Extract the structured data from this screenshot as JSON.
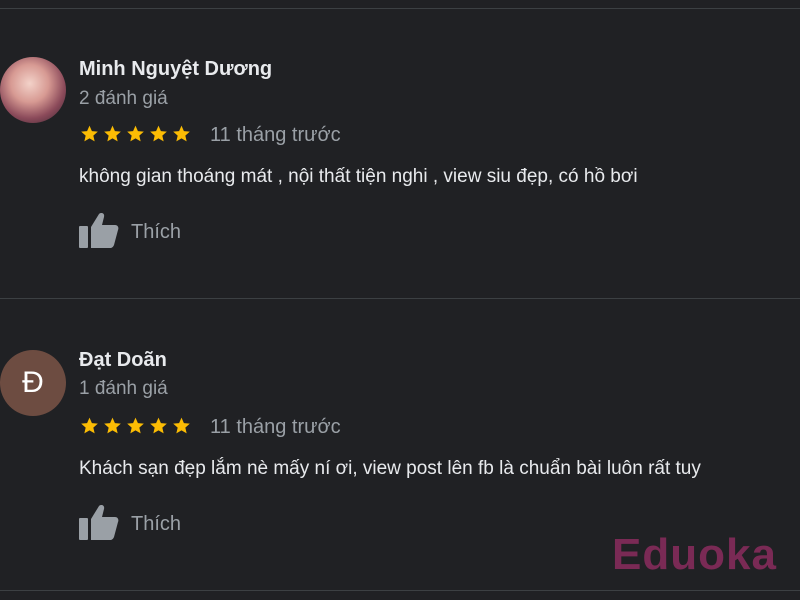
{
  "reviews": [
    {
      "name": "Minh Nguyệt Dương",
      "review_count": "2 đánh giá",
      "rating": 5,
      "time": "11 tháng trước",
      "text": "không gian thoáng mát , nội thất tiện nghi , view siu đẹp, có hồ bơi",
      "like_label": "Thích"
    },
    {
      "avatar_letter": "Đ",
      "name": "Đạt Doãn",
      "review_count": "1 đánh giá",
      "rating": 5,
      "time": "11 tháng trước",
      "text": "Khách sạn đẹp lắm nè mấy ní ơi, view post lên fb là chuẩn bài luôn rất tuy",
      "like_label": "Thích"
    }
  ],
  "watermark": "Eduoka",
  "colors": {
    "background": "#202124",
    "star": "#fbbc04",
    "avatar_letter_bg": "#6d4c41",
    "watermark": "#7a2a55"
  }
}
